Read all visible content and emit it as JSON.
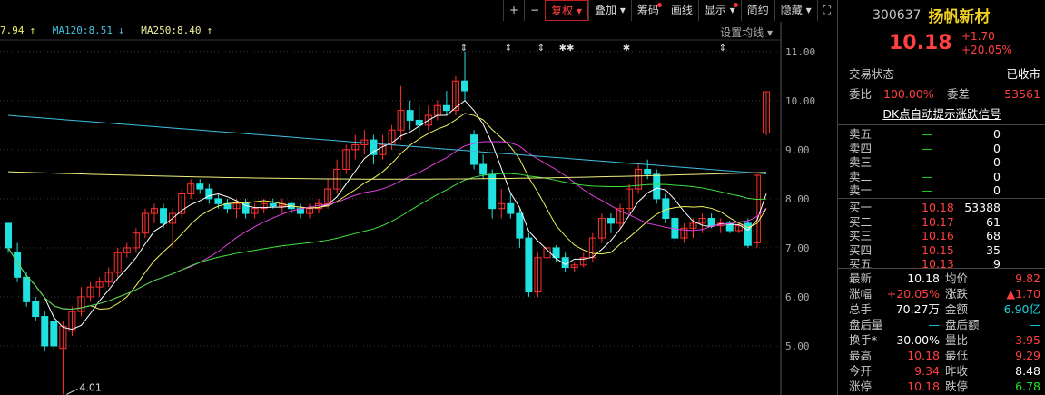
{
  "toolbar": [
    {
      "label": "+",
      "id": "zoom-in-button"
    },
    {
      "label": "−",
      "id": "zoom-out-button"
    },
    {
      "label": "复权 ▾",
      "id": "restore-rights-button",
      "active": true
    },
    {
      "label": "叠加 ▾",
      "id": "overlay-button"
    },
    {
      "label": "筹码",
      "id": "chips-button",
      "dot": true
    },
    {
      "label": "画线",
      "id": "draw-line-button"
    },
    {
      "label": "显示 ▾",
      "id": "display-button",
      "dot": true
    },
    {
      "label": "简约",
      "id": "simple-button"
    },
    {
      "label": "隐藏 ▾",
      "id": "hide-button"
    },
    {
      "label": "⛶",
      "id": "fullscreen-button"
    }
  ],
  "ma_bar": {
    "ma_prev": "7.94",
    "ma120": "MA120:8.51",
    "ma250": "MA250:8.40",
    "ma120_arrow": "↓",
    "ma250_arrow": "↑",
    "prev_arrow": "↑"
  },
  "settings_label": "设置均线 ▾",
  "y_ticks": [
    "11.00",
    "10.00",
    "9.00",
    "8.00",
    "7.00",
    "6.00",
    "5.00"
  ],
  "low_label": "4.01",
  "markers": [
    "⇕",
    "⇕",
    "⇕",
    "✱✱",
    "✱",
    "⇕"
  ],
  "colors": {
    "up": "#ff3030",
    "down": "#20e0e0",
    "ma5": "#ffffff",
    "ma10": "#f0f060",
    "ma20": "#e040e0",
    "ma60": "#40e040",
    "ma120": "#40c0e0",
    "ma250": "#f0f080"
  },
  "chart_data": {
    "type": "candlestick",
    "ylim": [
      4.0,
      11.2
    ],
    "candles": [
      [
        7.5,
        7.5,
        6.9,
        7.0
      ],
      [
        6.9,
        7.1,
        6.3,
        6.4
      ],
      [
        6.4,
        6.5,
        5.8,
        5.9
      ],
      [
        5.9,
        6.0,
        5.5,
        5.6
      ],
      [
        5.6,
        5.7,
        4.9,
        5.0
      ],
      [
        5.5,
        5.7,
        4.9,
        5.0
      ],
      [
        4.95,
        5.5,
        4.01,
        5.4
      ],
      [
        5.3,
        5.8,
        5.2,
        5.7
      ],
      [
        5.7,
        6.2,
        5.6,
        6.0
      ],
      [
        6.0,
        6.3,
        5.9,
        6.2
      ],
      [
        6.2,
        6.4,
        6.0,
        6.3
      ],
      [
        6.3,
        6.6,
        6.2,
        6.5
      ],
      [
        6.5,
        7.0,
        6.4,
        6.9
      ],
      [
        6.9,
        7.1,
        6.8,
        7.0
      ],
      [
        7.0,
        7.4,
        6.9,
        7.3
      ],
      [
        7.3,
        7.8,
        7.2,
        7.7
      ],
      [
        7.7,
        7.9,
        7.5,
        7.8
      ],
      [
        7.8,
        7.9,
        7.4,
        7.5
      ],
      [
        7.5,
        7.8,
        7.0,
        7.7
      ],
      [
        7.7,
        8.2,
        7.6,
        8.1
      ],
      [
        8.1,
        8.4,
        8.0,
        8.3
      ],
      [
        8.3,
        8.4,
        8.1,
        8.2
      ],
      [
        8.2,
        8.3,
        7.9,
        8.0
      ],
      [
        8.0,
        8.1,
        7.8,
        7.9
      ],
      [
        7.9,
        8.0,
        7.7,
        7.8
      ],
      [
        7.8,
        8.0,
        7.6,
        7.9
      ],
      [
        7.9,
        8.0,
        7.6,
        7.7
      ],
      [
        7.7,
        7.9,
        7.6,
        7.8
      ],
      [
        7.8,
        8.0,
        7.7,
        7.9
      ],
      [
        7.9,
        8.0,
        7.8,
        7.85
      ],
      [
        7.85,
        8.0,
        7.7,
        7.9
      ],
      [
        7.9,
        7.95,
        7.7,
        7.8
      ],
      [
        7.8,
        7.9,
        7.6,
        7.7
      ],
      [
        7.7,
        7.9,
        7.6,
        7.8
      ],
      [
        7.8,
        8.0,
        7.7,
        7.9
      ],
      [
        7.9,
        8.4,
        7.8,
        8.2
      ],
      [
        8.2,
        8.8,
        8.1,
        8.6
      ],
      [
        8.6,
        9.1,
        8.5,
        9.0
      ],
      [
        9.0,
        9.3,
        8.8,
        9.1
      ],
      [
        9.1,
        9.4,
        8.9,
        9.2
      ],
      [
        9.2,
        9.3,
        8.7,
        8.9
      ],
      [
        8.9,
        9.3,
        8.8,
        9.1
      ],
      [
        9.1,
        9.5,
        9.0,
        9.4
      ],
      [
        9.4,
        10.3,
        9.2,
        9.8
      ],
      [
        9.8,
        10.0,
        9.4,
        9.6
      ],
      [
        9.6,
        9.9,
        9.3,
        9.5
      ],
      [
        9.5,
        9.9,
        9.4,
        9.7
      ],
      [
        9.7,
        10.0,
        9.6,
        9.9
      ],
      [
        9.9,
        10.2,
        9.7,
        9.8
      ],
      [
        9.8,
        10.5,
        9.7,
        10.4
      ],
      [
        10.4,
        11.0,
        10.0,
        10.2
      ],
      [
        9.3,
        9.4,
        8.6,
        8.7
      ],
      [
        8.7,
        8.9,
        8.4,
        8.5
      ],
      [
        8.5,
        8.6,
        7.6,
        7.8
      ],
      [
        7.8,
        8.2,
        7.6,
        7.9
      ],
      [
        7.9,
        8.1,
        7.6,
        7.7
      ],
      [
        7.7,
        7.8,
        7.0,
        7.2
      ],
      [
        7.2,
        7.3,
        6.0,
        6.1
      ],
      [
        6.1,
        6.9,
        6.0,
        6.8
      ],
      [
        6.8,
        7.1,
        6.7,
        7.0
      ],
      [
        7.0,
        7.05,
        6.7,
        6.8
      ],
      [
        6.8,
        6.9,
        6.5,
        6.6
      ],
      [
        6.6,
        6.7,
        6.5,
        6.65
      ],
      [
        6.65,
        6.9,
        6.6,
        6.8
      ],
      [
        6.8,
        7.3,
        6.7,
        7.2
      ],
      [
        7.2,
        7.7,
        7.1,
        7.6
      ],
      [
        7.6,
        7.7,
        7.3,
        7.5
      ],
      [
        7.5,
        7.9,
        7.4,
        7.8
      ],
      [
        7.8,
        8.3,
        7.7,
        8.2
      ],
      [
        8.2,
        8.7,
        8.1,
        8.6
      ],
      [
        8.6,
        8.8,
        8.4,
        8.5
      ],
      [
        8.5,
        8.6,
        7.9,
        8.0
      ],
      [
        8.0,
        8.1,
        7.5,
        7.6
      ],
      [
        7.6,
        7.7,
        7.1,
        7.2
      ],
      [
        7.2,
        7.5,
        7.1,
        7.4
      ],
      [
        7.4,
        7.6,
        7.2,
        7.5
      ],
      [
        7.5,
        7.7,
        7.3,
        7.6
      ],
      [
        7.6,
        7.7,
        7.4,
        7.45
      ],
      [
        7.45,
        7.6,
        7.3,
        7.5
      ],
      [
        7.5,
        7.55,
        7.3,
        7.35
      ],
      [
        7.35,
        7.5,
        7.3,
        7.45
      ],
      [
        7.5,
        7.6,
        7.0,
        7.05
      ],
      [
        7.1,
        8.5,
        7.0,
        8.48
      ],
      [
        9.34,
        10.18,
        9.29,
        10.18
      ]
    ]
  },
  "quote": {
    "code": "300637",
    "name": "扬帆新材",
    "price": "10.18",
    "change": "+1.70",
    "change_pct": "+20.05%",
    "status_label": "交易状态",
    "status_value": "已收市",
    "wb_label": "委比",
    "wb_value": "100.00%",
    "wc_label": "委差",
    "wc_value": "53561",
    "signal_link": "DK点自动提示涨跌信号",
    "asks": [
      {
        "label": "卖五",
        "price": "—",
        "vol": "0"
      },
      {
        "label": "卖四",
        "price": "—",
        "vol": "0"
      },
      {
        "label": "卖三",
        "price": "—",
        "vol": "0"
      },
      {
        "label": "卖二",
        "price": "—",
        "vol": "0"
      },
      {
        "label": "卖一",
        "price": "—",
        "vol": "0"
      }
    ],
    "bids": [
      {
        "label": "买一",
        "price": "10.18",
        "vol": "53388"
      },
      {
        "label": "买二",
        "price": "10.17",
        "vol": "61"
      },
      {
        "label": "买三",
        "price": "10.16",
        "vol": "68"
      },
      {
        "label": "买四",
        "price": "10.15",
        "vol": "35"
      },
      {
        "label": "买五",
        "price": "10.13",
        "vol": "9"
      }
    ],
    "stats": [
      [
        "最新",
        "10.18",
        "均价",
        "9.82"
      ],
      [
        "涨幅",
        "+20.05%",
        "涨跌",
        "▲1.70"
      ],
      [
        "总手",
        "70.27万",
        "金额",
        "6.90亿"
      ],
      [
        "盘后量",
        "—",
        "盘后额",
        "—"
      ],
      [
        "换手*",
        "30.00%",
        "量比",
        "3.95"
      ],
      [
        "最高",
        "10.18",
        "最低",
        "9.29"
      ],
      [
        "今开",
        "9.34",
        "昨收",
        "8.48"
      ],
      [
        "涨停",
        "10.18",
        "跌停",
        "6.78"
      ]
    ]
  }
}
